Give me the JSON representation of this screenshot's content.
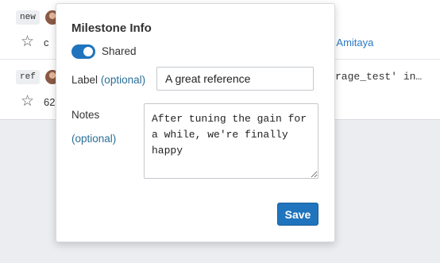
{
  "background_list": {
    "rows": [
      {
        "tag": "new",
        "partial_text": "c",
        "link_text": "y Amitaya"
      },
      {
        "tag": "ref",
        "partial_code": "rage_test' in…",
        "partial_number": "62"
      }
    ]
  },
  "milestone_popover": {
    "title": "Milestone Info",
    "shared": {
      "label": "Shared",
      "enabled": true
    },
    "label_field": {
      "label": "Label",
      "optional_hint": "(optional)",
      "value": "A great reference"
    },
    "notes_field": {
      "label": "Notes",
      "optional_hint": "(optional)",
      "value": "After tuning the gain for a while, we're finally happy"
    },
    "save_button": "Save"
  },
  "colors": {
    "accent": "#1f74bd",
    "link": "#2a78c4"
  }
}
